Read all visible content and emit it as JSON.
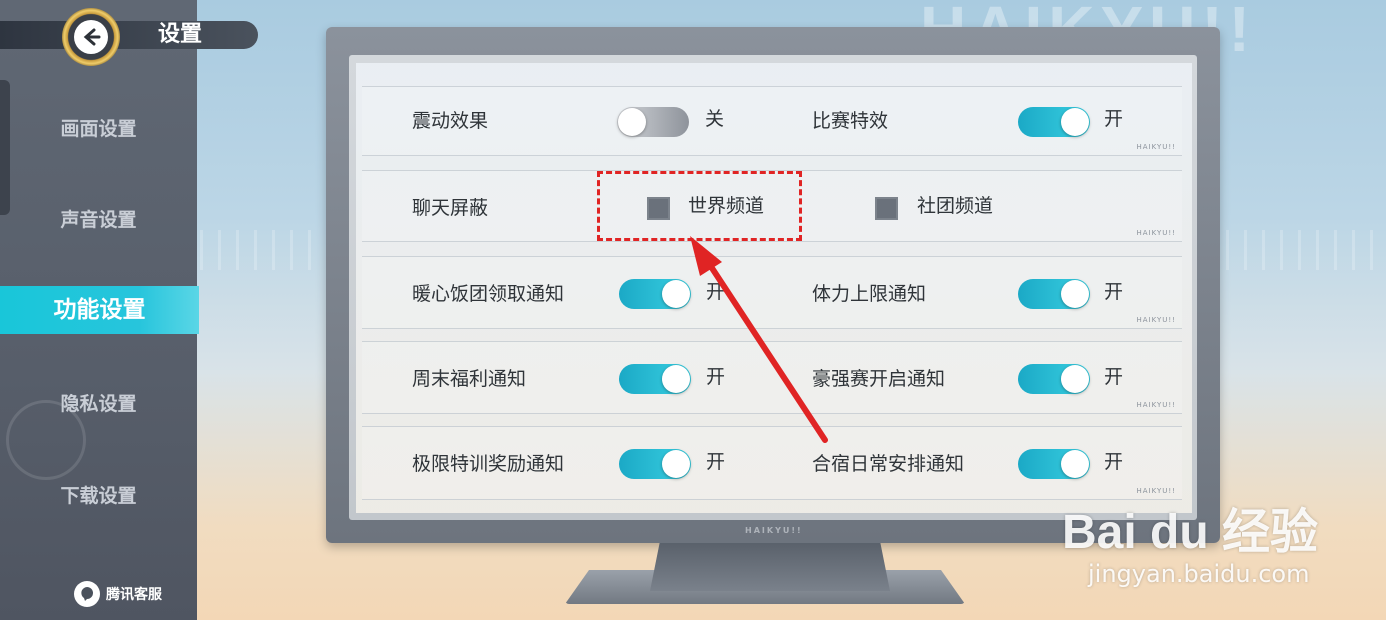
{
  "header": {
    "title": "设置"
  },
  "sidebar": {
    "items": [
      {
        "label": "画面设置",
        "active": false
      },
      {
        "label": "声音设置",
        "active": false
      },
      {
        "label": "功能设置",
        "active": true
      },
      {
        "label": "隐私设置",
        "active": false
      },
      {
        "label": "下载设置",
        "active": false
      }
    ],
    "service_label": "腾讯客服"
  },
  "background": {
    "brand_text": "HAIKYU!!"
  },
  "monitor": {
    "bezel_brand": "HAIKYU!!",
    "row_mark": "HAIKYU!!"
  },
  "settings": {
    "row1": {
      "left": {
        "label": "震动效果",
        "state": "关",
        "on": false
      },
      "right": {
        "label": "比赛特效",
        "state": "开",
        "on": true
      }
    },
    "row2": {
      "label": "聊天屏蔽",
      "options": [
        {
          "label": "世界频道",
          "checked": false
        },
        {
          "label": "社团频道",
          "checked": false
        }
      ]
    },
    "row3": {
      "left": {
        "label": "暖心饭团领取通知",
        "state": "开",
        "on": true
      },
      "right": {
        "label": "体力上限通知",
        "state": "开",
        "on": true
      }
    },
    "row4": {
      "left": {
        "label": "周末福利通知",
        "state": "开",
        "on": true
      },
      "right": {
        "label": "豪强赛开启通知",
        "state": "开",
        "on": true
      }
    },
    "row5": {
      "left": {
        "label": "极限特训奖励通知",
        "state": "开",
        "on": true
      },
      "right": {
        "label": "合宿日常安排通知",
        "state": "开",
        "on": true
      }
    }
  },
  "annotation": {
    "color": "#e02424"
  },
  "watermark": {
    "main": "Bai du 经验",
    "url": "jingyan.baidu.com"
  },
  "colors": {
    "accent": "#27c5dc",
    "sidebar": "#5a616c"
  }
}
